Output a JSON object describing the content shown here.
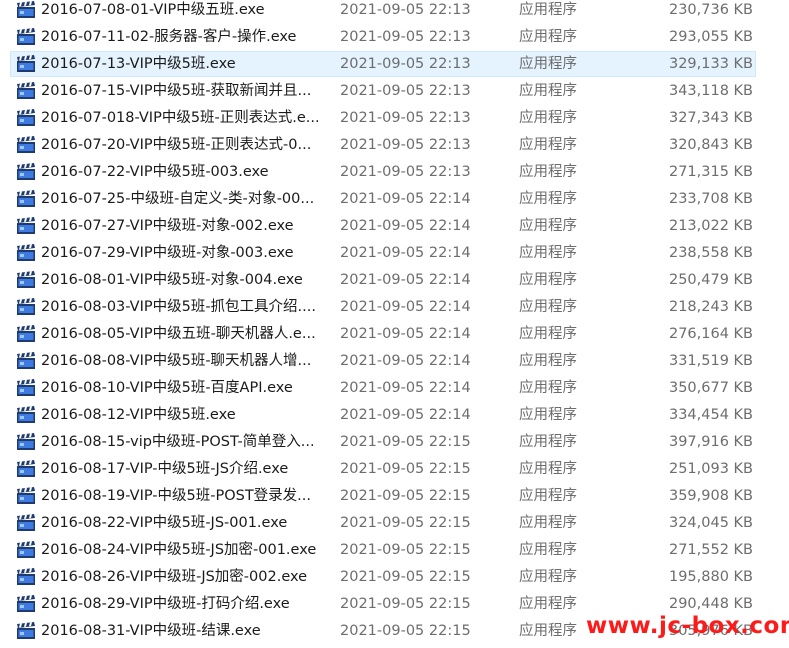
{
  "colors": {
    "selection": "#e5f3ff",
    "selection_border": "#cde8ff",
    "watermark": "#ff1a1a"
  },
  "icon_name": "video-clapperboard-icon",
  "selected_index": 2,
  "files": [
    {
      "name": "2016-07-08-01-VIP中级五班.exe",
      "date": "2021-09-05 22:13",
      "type": "应用程序",
      "size": "230,736 KB"
    },
    {
      "name": "2016-07-11-02-服务器-客户-操作.exe",
      "date": "2021-09-05 22:13",
      "type": "应用程序",
      "size": "293,055 KB"
    },
    {
      "name": "2016-07-13-VIP中级5班.exe",
      "date": "2021-09-05 22:13",
      "type": "应用程序",
      "size": "329,133 KB"
    },
    {
      "name": "2016-07-15-VIP中级5班-获取新闻并且...",
      "date": "2021-09-05 22:13",
      "type": "应用程序",
      "size": "343,118 KB"
    },
    {
      "name": "2016-07-018-VIP中级5班-正则表达式.e...",
      "date": "2021-09-05 22:13",
      "type": "应用程序",
      "size": "327,343 KB"
    },
    {
      "name": "2016-07-20-VIP中级5班-正则表达式-0...",
      "date": "2021-09-05 22:13",
      "type": "应用程序",
      "size": "320,843 KB"
    },
    {
      "name": "2016-07-22-VIP中级5班-003.exe",
      "date": "2021-09-05 22:13",
      "type": "应用程序",
      "size": "271,315 KB"
    },
    {
      "name": "2016-07-25-中级班-自定义-类-对象-00...",
      "date": "2021-09-05 22:14",
      "type": "应用程序",
      "size": "233,708 KB"
    },
    {
      "name": "2016-07-27-VIP中级班-对象-002.exe",
      "date": "2021-09-05 22:14",
      "type": "应用程序",
      "size": "213,022 KB"
    },
    {
      "name": "2016-07-29-VIP中级班-对象-003.exe",
      "date": "2021-09-05 22:14",
      "type": "应用程序",
      "size": "238,558 KB"
    },
    {
      "name": "2016-08-01-VIP中级5班-对象-004.exe",
      "date": "2021-09-05 22:14",
      "type": "应用程序",
      "size": "250,479 KB"
    },
    {
      "name": "2016-08-03-VIP中级5班-抓包工具介绍....",
      "date": "2021-09-05 22:14",
      "type": "应用程序",
      "size": "218,243 KB"
    },
    {
      "name": "2016-08-05-VIP中级五班-聊天机器人.e...",
      "date": "2021-09-05 22:14",
      "type": "应用程序",
      "size": "276,164 KB"
    },
    {
      "name": "2016-08-08-VIP中级5班-聊天机器人增...",
      "date": "2021-09-05 22:14",
      "type": "应用程序",
      "size": "331,519 KB"
    },
    {
      "name": "2016-08-10-VIP中级5班-百度API.exe",
      "date": "2021-09-05 22:14",
      "type": "应用程序",
      "size": "350,677 KB"
    },
    {
      "name": "2016-08-12-VIP中级5班.exe",
      "date": "2021-09-05 22:14",
      "type": "应用程序",
      "size": "334,454 KB"
    },
    {
      "name": "2016-08-15-vip中级班-POST-简单登入...",
      "date": "2021-09-05 22:15",
      "type": "应用程序",
      "size": "397,916 KB"
    },
    {
      "name": "2016-08-17-VIP-中级5班-JS介绍.exe",
      "date": "2021-09-05 22:15",
      "type": "应用程序",
      "size": "251,093 KB"
    },
    {
      "name": "2016-08-19-VIP-中级5班-POST登录发...",
      "date": "2021-09-05 22:15",
      "type": "应用程序",
      "size": "359,908 KB"
    },
    {
      "name": "2016-08-22-VIP中级5班-JS-001.exe",
      "date": "2021-09-05 22:15",
      "type": "应用程序",
      "size": "324,045 KB"
    },
    {
      "name": "2016-08-24-VIP中级5班-JS加密-001.exe",
      "date": "2021-09-05 22:15",
      "type": "应用程序",
      "size": "271,552 KB"
    },
    {
      "name": "2016-08-26-VIP中级班-JS加密-002.exe",
      "date": "2021-09-05 22:15",
      "type": "应用程序",
      "size": "195,880 KB"
    },
    {
      "name": "2016-08-29-VIP中级班-打码介绍.exe",
      "date": "2021-09-05 22:15",
      "type": "应用程序",
      "size": "290,448 KB"
    },
    {
      "name": "2016-08-31-VIP中级班-结课.exe",
      "date": "2021-09-05 22:15",
      "type": "应用程序",
      "size": "305,976 KB"
    }
  ],
  "watermark": "www.jc-box.com"
}
